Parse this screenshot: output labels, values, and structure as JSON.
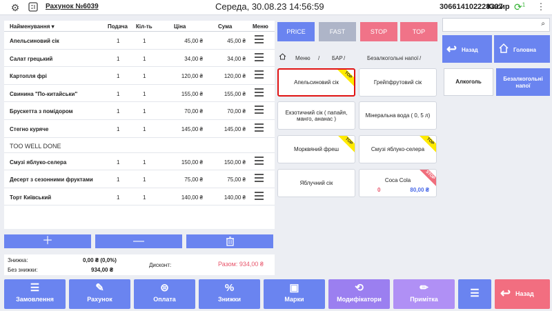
{
  "topbar": {
    "bill_label": "Рахунок №6039",
    "datetime": "Середа, 30.08.23 14:56:59",
    "code": "306614102228307",
    "role": "Касир",
    "sync_count": "1"
  },
  "table": {
    "headers": {
      "name": "Найменування",
      "serve": "Подача",
      "qty": "Кіл-ть",
      "price": "Ціна",
      "sum": "Сума",
      "menu": "Меню"
    },
    "rows": [
      {
        "name": "Апельсиновий сік",
        "serve": "1",
        "qty": "1",
        "price": "45,00 ₴",
        "sum": "45,00 ₴"
      },
      {
        "name": "Салат грецький",
        "serve": "1",
        "qty": "1",
        "price": "34,00 ₴",
        "sum": "34,00 ₴"
      },
      {
        "name": "Картопля фрі",
        "serve": "1",
        "qty": "1",
        "price": "120,00 ₴",
        "sum": "120,00 ₴"
      },
      {
        "name": "Свинина \"По-китайськи\"",
        "serve": "1",
        "qty": "1",
        "price": "155,00 ₴",
        "sum": "155,00 ₴"
      },
      {
        "name": "Брускетта з помідором",
        "serve": "1",
        "qty": "1",
        "price": "70,00 ₴",
        "sum": "70,00 ₴"
      },
      {
        "name": "Стегно куряче",
        "serve": "1",
        "qty": "1",
        "price": "145,00 ₴",
        "sum": "145,00 ₴"
      },
      {
        "name": "Смузі яблуко-селера",
        "serve": "1",
        "qty": "1",
        "price": "150,00 ₴",
        "sum": "150,00 ₴"
      },
      {
        "name": "Десерт з сезонними фруктами",
        "serve": "1",
        "qty": "1",
        "price": "75,00 ₴",
        "sum": "75,00 ₴"
      },
      {
        "name": "Торт Київський",
        "serve": "1",
        "qty": "1",
        "price": "140,00 ₴",
        "sum": "140,00 ₴"
      }
    ],
    "note": "TOO WELL DONE"
  },
  "summary": {
    "discount_label": "Знижка:",
    "discount_value": "0,00 ₴  (0,0%)",
    "no_discount_label": "Без знижки:",
    "no_discount_value": "934,00 ₴",
    "discount_card_label": "Дисконт:",
    "total": "Разом: 934,00 ₴"
  },
  "filters": {
    "price": "PRICE",
    "fast": "FAST",
    "stop": "STOP",
    "top": "TOP"
  },
  "breadcrumb": {
    "menu": "Меню",
    "bar": "БАР",
    "category": "Безалкогольні напої",
    "sep": "/"
  },
  "tiles": [
    {
      "label": "Апельсиновий сік",
      "badge": "TOP"
    },
    {
      "label": "Грейпфрутовий сік",
      "badge": ""
    },
    {
      "label": "Екзотичний сік ( папайя, манго, ананас )",
      "badge": ""
    },
    {
      "label": "Мінеральна вода ( 0, 5 л)",
      "badge": ""
    },
    {
      "label": "Морквяний фреш",
      "badge": "TOP"
    },
    {
      "label": "Смузі яблуко-селера",
      "badge": "TOP"
    },
    {
      "label": "Яблучний сік",
      "badge": ""
    },
    {
      "label": "Coca Cola",
      "badge": "STOP",
      "stock": "0",
      "price": "80,00 ₴"
    }
  ],
  "right": {
    "back": "Назад",
    "home": "Головна",
    "alcohol": "Алкоголь",
    "soft": "Безалкогольні напої"
  },
  "bottom": {
    "order": "Замовлення",
    "bill": "Рахунок",
    "payment": "Оплата",
    "discounts": "Знижки",
    "marks": "Марки",
    "modifiers": "Модифікатори",
    "note": "Примітка",
    "back": "Назад"
  },
  "colors": {
    "accent": "#6a84f0",
    "stop": "#f07388",
    "fast": "#aeb5c8",
    "modifiers": "#9b7ff0",
    "note": "#b090f5",
    "back": "#f26e80"
  }
}
